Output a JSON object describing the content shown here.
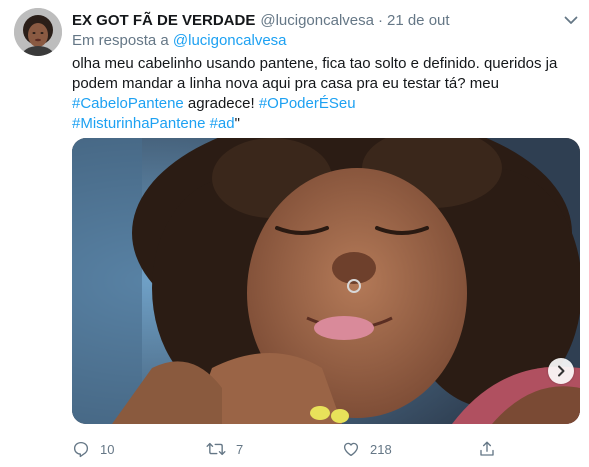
{
  "tweet": {
    "display_name": "EX GOT FÃ DE VERDADE",
    "handle": "@lucigoncalvesa",
    "separator": "·",
    "time": "21 de out",
    "reply_prefix": "Em resposta a",
    "reply_to": "@lucigoncalvesa",
    "text": {
      "line1": "olha meu cabelinho usando pantene, fica tao solto e definido. queridos ja",
      "line2": "podem mandar a linha nova aqui pra casa pra eu testar tá? meu",
      "line3_tag1": "#CabeloPantene",
      "line3_mid": " agradece! ",
      "line3_tag2": "#OPoderÉSeu",
      "line4_tag1": "#MisturinhaPantene",
      "line4_space": " ",
      "line4_tag2": "#ad",
      "line4_end": "\""
    },
    "media": {
      "alt_icon": "photo-of-smiling-woman-curly-hair"
    },
    "actions": {
      "replies": "10",
      "retweets": "7",
      "likes": "218"
    }
  },
  "colors": {
    "link": "#1da1f2",
    "secondary": "#657786",
    "primary_text": "#14171a"
  }
}
